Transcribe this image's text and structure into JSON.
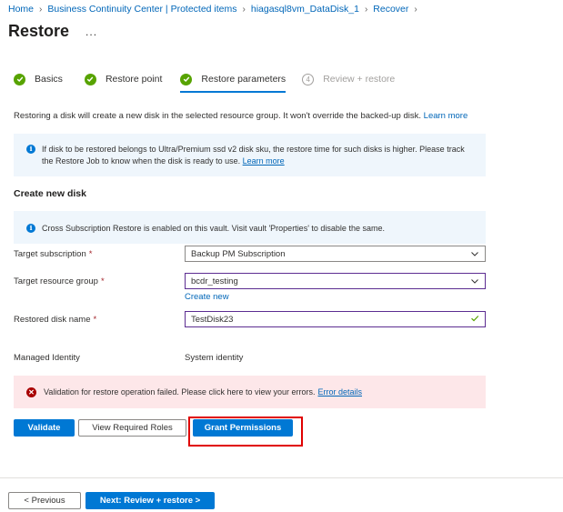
{
  "breadcrumb": [
    "Home",
    "Business Continuity Center | Protected items",
    "hiagasql8vm_DataDisk_1",
    "Recover"
  ],
  "page": {
    "title": "Restore",
    "more_label": "..."
  },
  "wizard": {
    "steps": [
      {
        "label": "Basics",
        "state": "done"
      },
      {
        "label": "Restore point",
        "state": "done"
      },
      {
        "label": "Restore parameters",
        "state": "active"
      },
      {
        "label": "Review + restore",
        "state": "pending",
        "number": "4"
      }
    ]
  },
  "intro": {
    "text": "Restoring a disk will create a new disk in the selected resource group. It won't override the backed-up disk.",
    "link": "Learn more"
  },
  "info1": {
    "line1": "If disk to be restored belongs to Ultra/Premium ssd v2 disk sku, the restore time for such disks is higher. Please track",
    "line2": "the Restore Job to know when the disk is ready to use.",
    "link": "Learn more"
  },
  "section_title": "Create new disk",
  "info2": {
    "text": "Cross Subscription Restore is enabled on this vault. Visit vault 'Properties' to disable the same."
  },
  "form": {
    "subscription_label": "Target subscription",
    "subscription_value": "Backup PM Subscription",
    "resource_group_label": "Target resource group",
    "resource_group_value": "bcdr_testing",
    "create_new": "Create new",
    "disk_name_label": "Restored disk name",
    "disk_name_value": "TestDisk23",
    "required_mark": "*",
    "identity_label": "Managed Identity",
    "identity_value": "System identity"
  },
  "error": {
    "text": "Validation for restore operation failed. Please click here to view your errors.",
    "link": "Error details"
  },
  "actions": {
    "validate": "Validate",
    "view_roles": "View Required Roles",
    "grant_permissions": "Grant Permissions"
  },
  "footer": {
    "previous": "< Previous",
    "next": "Next: Review + restore >"
  },
  "colors": {
    "accent": "#0078d4",
    "success": "#57a300",
    "error": "#a80000",
    "highlight": "#e00000",
    "info_bg": "#eff6fc",
    "error_bg": "#fde7e9"
  }
}
